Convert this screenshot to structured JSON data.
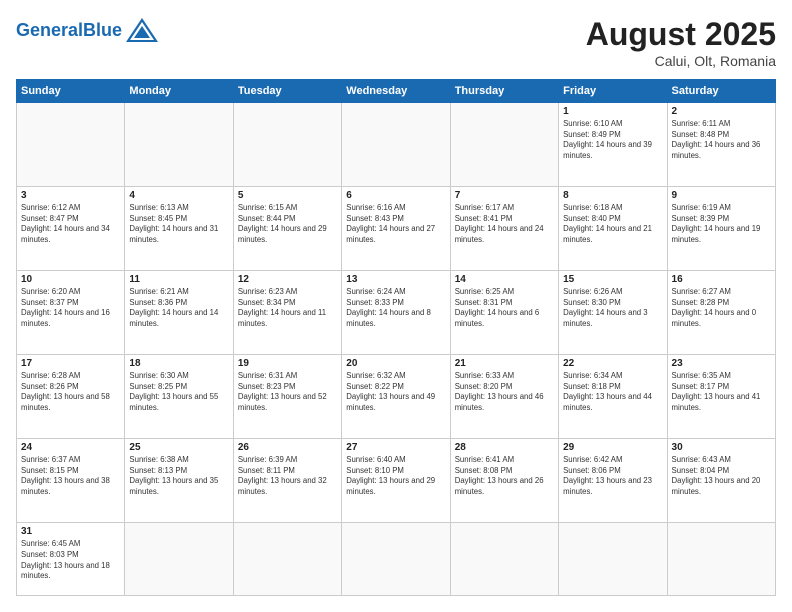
{
  "logo": {
    "text_general": "General",
    "text_blue": "Blue"
  },
  "header": {
    "month": "August 2025",
    "location": "Calui, Olt, Romania"
  },
  "weekdays": [
    "Sunday",
    "Monday",
    "Tuesday",
    "Wednesday",
    "Thursday",
    "Friday",
    "Saturday"
  ],
  "weeks": [
    [
      {
        "day": "",
        "info": ""
      },
      {
        "day": "",
        "info": ""
      },
      {
        "day": "",
        "info": ""
      },
      {
        "day": "",
        "info": ""
      },
      {
        "day": "",
        "info": ""
      },
      {
        "day": "1",
        "info": "Sunrise: 6:10 AM\nSunset: 8:49 PM\nDaylight: 14 hours and 39 minutes."
      },
      {
        "day": "2",
        "info": "Sunrise: 6:11 AM\nSunset: 8:48 PM\nDaylight: 14 hours and 36 minutes."
      }
    ],
    [
      {
        "day": "3",
        "info": "Sunrise: 6:12 AM\nSunset: 8:47 PM\nDaylight: 14 hours and 34 minutes."
      },
      {
        "day": "4",
        "info": "Sunrise: 6:13 AM\nSunset: 8:45 PM\nDaylight: 14 hours and 31 minutes."
      },
      {
        "day": "5",
        "info": "Sunrise: 6:15 AM\nSunset: 8:44 PM\nDaylight: 14 hours and 29 minutes."
      },
      {
        "day": "6",
        "info": "Sunrise: 6:16 AM\nSunset: 8:43 PM\nDaylight: 14 hours and 27 minutes."
      },
      {
        "day": "7",
        "info": "Sunrise: 6:17 AM\nSunset: 8:41 PM\nDaylight: 14 hours and 24 minutes."
      },
      {
        "day": "8",
        "info": "Sunrise: 6:18 AM\nSunset: 8:40 PM\nDaylight: 14 hours and 21 minutes."
      },
      {
        "day": "9",
        "info": "Sunrise: 6:19 AM\nSunset: 8:39 PM\nDaylight: 14 hours and 19 minutes."
      }
    ],
    [
      {
        "day": "10",
        "info": "Sunrise: 6:20 AM\nSunset: 8:37 PM\nDaylight: 14 hours and 16 minutes."
      },
      {
        "day": "11",
        "info": "Sunrise: 6:21 AM\nSunset: 8:36 PM\nDaylight: 14 hours and 14 minutes."
      },
      {
        "day": "12",
        "info": "Sunrise: 6:23 AM\nSunset: 8:34 PM\nDaylight: 14 hours and 11 minutes."
      },
      {
        "day": "13",
        "info": "Sunrise: 6:24 AM\nSunset: 8:33 PM\nDaylight: 14 hours and 8 minutes."
      },
      {
        "day": "14",
        "info": "Sunrise: 6:25 AM\nSunset: 8:31 PM\nDaylight: 14 hours and 6 minutes."
      },
      {
        "day": "15",
        "info": "Sunrise: 6:26 AM\nSunset: 8:30 PM\nDaylight: 14 hours and 3 minutes."
      },
      {
        "day": "16",
        "info": "Sunrise: 6:27 AM\nSunset: 8:28 PM\nDaylight: 14 hours and 0 minutes."
      }
    ],
    [
      {
        "day": "17",
        "info": "Sunrise: 6:28 AM\nSunset: 8:26 PM\nDaylight: 13 hours and 58 minutes."
      },
      {
        "day": "18",
        "info": "Sunrise: 6:30 AM\nSunset: 8:25 PM\nDaylight: 13 hours and 55 minutes."
      },
      {
        "day": "19",
        "info": "Sunrise: 6:31 AM\nSunset: 8:23 PM\nDaylight: 13 hours and 52 minutes."
      },
      {
        "day": "20",
        "info": "Sunrise: 6:32 AM\nSunset: 8:22 PM\nDaylight: 13 hours and 49 minutes."
      },
      {
        "day": "21",
        "info": "Sunrise: 6:33 AM\nSunset: 8:20 PM\nDaylight: 13 hours and 46 minutes."
      },
      {
        "day": "22",
        "info": "Sunrise: 6:34 AM\nSunset: 8:18 PM\nDaylight: 13 hours and 44 minutes."
      },
      {
        "day": "23",
        "info": "Sunrise: 6:35 AM\nSunset: 8:17 PM\nDaylight: 13 hours and 41 minutes."
      }
    ],
    [
      {
        "day": "24",
        "info": "Sunrise: 6:37 AM\nSunset: 8:15 PM\nDaylight: 13 hours and 38 minutes."
      },
      {
        "day": "25",
        "info": "Sunrise: 6:38 AM\nSunset: 8:13 PM\nDaylight: 13 hours and 35 minutes."
      },
      {
        "day": "26",
        "info": "Sunrise: 6:39 AM\nSunset: 8:11 PM\nDaylight: 13 hours and 32 minutes."
      },
      {
        "day": "27",
        "info": "Sunrise: 6:40 AM\nSunset: 8:10 PM\nDaylight: 13 hours and 29 minutes."
      },
      {
        "day": "28",
        "info": "Sunrise: 6:41 AM\nSunset: 8:08 PM\nDaylight: 13 hours and 26 minutes."
      },
      {
        "day": "29",
        "info": "Sunrise: 6:42 AM\nSunset: 8:06 PM\nDaylight: 13 hours and 23 minutes."
      },
      {
        "day": "30",
        "info": "Sunrise: 6:43 AM\nSunset: 8:04 PM\nDaylight: 13 hours and 20 minutes."
      }
    ],
    [
      {
        "day": "31",
        "info": "Sunrise: 6:45 AM\nSunset: 8:03 PM\nDaylight: 13 hours and 18 minutes."
      },
      {
        "day": "",
        "info": ""
      },
      {
        "day": "",
        "info": ""
      },
      {
        "day": "",
        "info": ""
      },
      {
        "day": "",
        "info": ""
      },
      {
        "day": "",
        "info": ""
      },
      {
        "day": "",
        "info": ""
      }
    ]
  ]
}
